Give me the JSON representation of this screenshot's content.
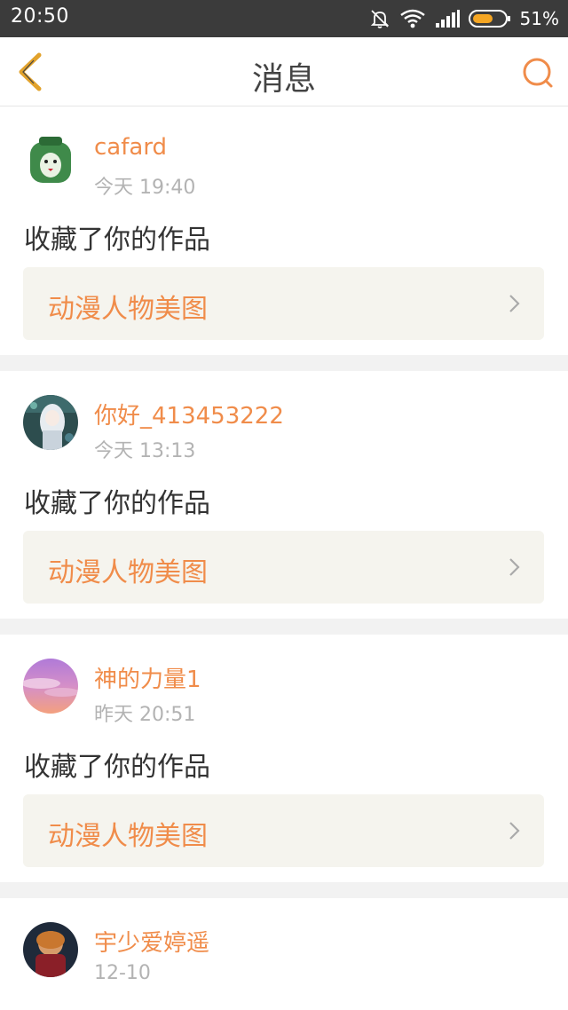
{
  "status_bar": {
    "time": "20:50",
    "battery": "51%"
  },
  "header": {
    "title": "消息",
    "back_icon": "back-chevron-icon",
    "search_icon": "search-icon"
  },
  "colors": {
    "accent": "#f08c4a",
    "back_icon": "#e2a22b",
    "status_bar": "#3b3b3b",
    "work_bg": "#f5f4ee"
  },
  "messages": [
    {
      "username": "cafard",
      "time": "今天 19:40",
      "action": "收藏了你的作品",
      "work_title": "动漫人物美图"
    },
    {
      "username": "你好_413453222",
      "time": "今天 13:13",
      "action": "收藏了你的作品",
      "work_title": "动漫人物美图"
    },
    {
      "username": "神的力量1",
      "time": "昨天 20:51",
      "action": "收藏了你的作品",
      "work_title": "动漫人物美图"
    },
    {
      "username": "宇少爱婷遥",
      "time": "12-10"
    }
  ]
}
